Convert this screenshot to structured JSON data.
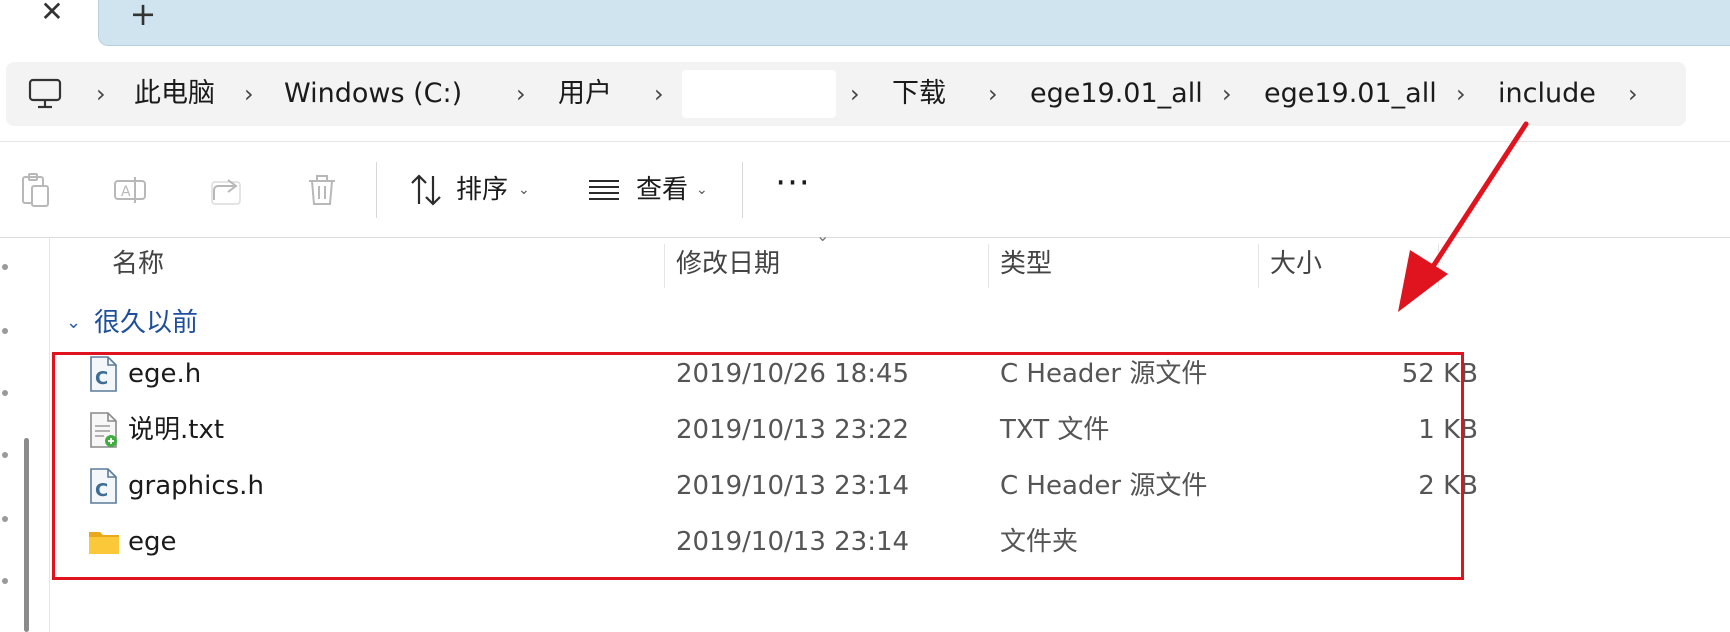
{
  "tabbar": {
    "close_glyph": "✕",
    "new_tab_glyph": "+"
  },
  "address": {
    "crumbs": [
      "此电脑",
      "Windows (C:)",
      "用户",
      "",
      "下载",
      "ege19.01_all",
      "ege19.01_all",
      "include"
    ],
    "separator": "›"
  },
  "toolbar": {
    "sort_label": "排序",
    "view_label": "查看",
    "more_glyph": "···",
    "chevron": "⌄"
  },
  "columns": {
    "name": "名称",
    "date": "修改日期",
    "type": "类型",
    "size": "大小"
  },
  "group": {
    "label": "很久以前",
    "chevron": "⌄"
  },
  "files": [
    {
      "name": "ege.h",
      "date": "2019/10/26 18:45",
      "type": "C Header 源文件",
      "size": "52 KB",
      "icon": "c-header-file-icon"
    },
    {
      "name": "说明.txt",
      "date": "2019/10/13 23:22",
      "type": "TXT 文件",
      "size": "1 KB",
      "icon": "text-file-icon"
    },
    {
      "name": "graphics.h",
      "date": "2019/10/13 23:14",
      "type": "C Header 源文件",
      "size": "2 KB",
      "icon": "c-header-file-icon"
    },
    {
      "name": "ege",
      "date": "2019/10/13 23:14",
      "type": "文件夹",
      "size": "",
      "icon": "folder-icon"
    }
  ],
  "colors": {
    "annotation_red": "#e0141e",
    "tab_strip": "#cfe4ef",
    "group_blue": "#1e4f9c"
  }
}
